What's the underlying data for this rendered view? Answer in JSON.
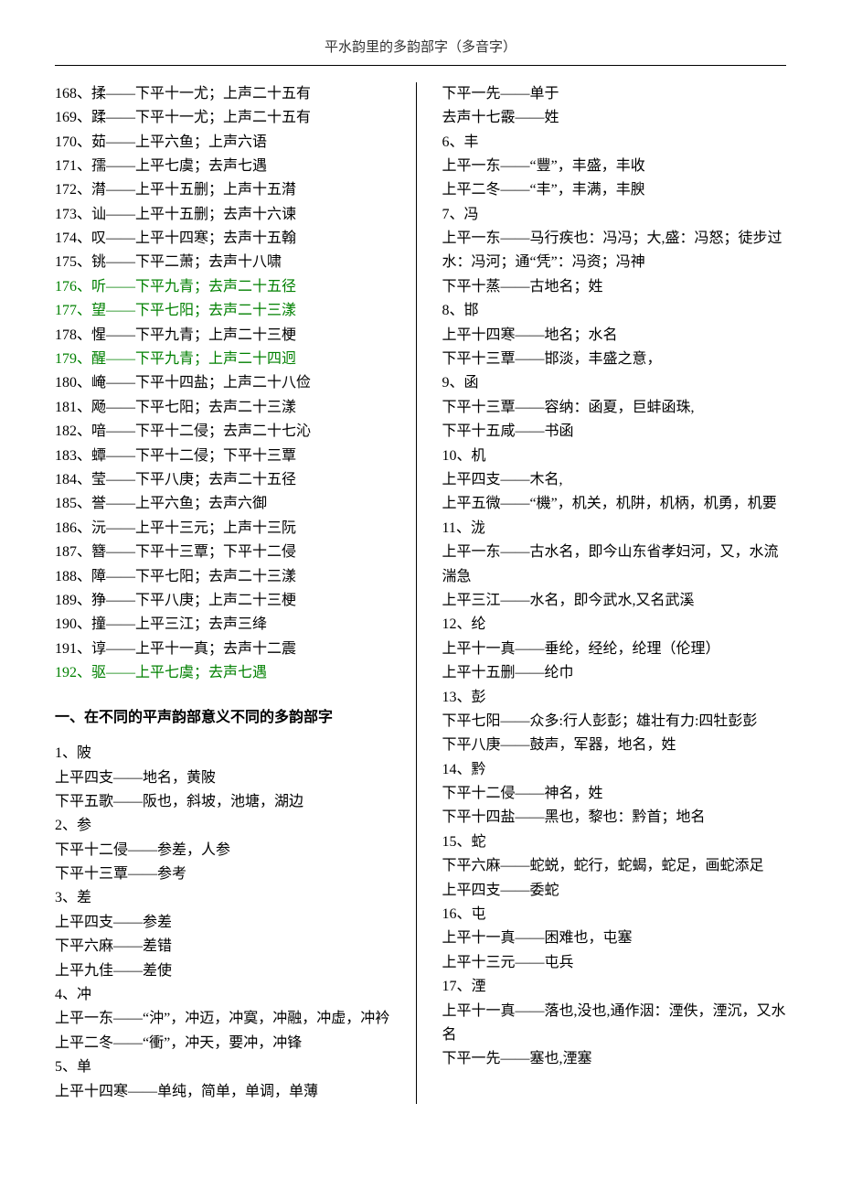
{
  "header": "平水韵里的多韵部字（多音字）",
  "left": {
    "items": [
      {
        "t": "168、揉——下平十一尤；上声二十五有"
      },
      {
        "t": "169、蹂——下平十一尤；上声二十五有"
      },
      {
        "t": "170、茹——上平六鱼；上声六语"
      },
      {
        "t": "171、孺——上平七虞；去声七遇"
      },
      {
        "t": "172、潸——上平十五删；上声十五潸"
      },
      {
        "t": "173、讪——上平十五删；去声十六谏"
      },
      {
        "t": "174、叹——上平十四寒；去声十五翰"
      },
      {
        "t": "175、铫——下平二萧；去声十八啸"
      },
      {
        "t": "176、听——下平九青；去声二十五径",
        "c": "green"
      },
      {
        "t": "177、望——下平七阳；去声二十三漾",
        "c": "green"
      },
      {
        "t": "178、惺——下平九青；上声二十三梗"
      },
      {
        "t": "179、醒——下平九青；上声二十四迥",
        "c": "green"
      },
      {
        "t": "180、崦——下平十四盐；上声二十八俭"
      },
      {
        "t": "181、飏——下平七阳；去声二十三漾"
      },
      {
        "t": "182、喑——下平十二侵；去声二十七沁"
      },
      {
        "t": "183、蟫——下平十二侵；下平十三覃"
      },
      {
        "t": "184、莹——下平八庚；去声二十五径"
      },
      {
        "t": "185、誉——上平六鱼；去声六御"
      },
      {
        "t": "186、沅——上平十三元；上声十三阮"
      },
      {
        "t": "187、簪——下平十三覃；下平十二侵"
      },
      {
        "t": "188、障——下平七阳；去声二十三漾"
      },
      {
        "t": "189、狰——下平八庚；上声二十三梗"
      },
      {
        "t": "190、撞——上平三江；去声三绛"
      },
      {
        "t": "191、谆——上平十一真；去声十二震"
      },
      {
        "t": "192、驱——上平七虞；去声七遇",
        "c": "green"
      }
    ],
    "section_title": "一、在不同的平声韵部意义不同的多韵部字",
    "section": [
      "1、陂",
      "上平四支——地名，黄陂",
      "下平五歌——阪也，斜坡，池塘，湖边",
      "2、参",
      "下平十二侵——参差，人参",
      "下平十三覃——参考",
      "3、差",
      "上平四支——参差",
      "下平六麻——差错",
      "上平九佳——差使",
      "4、冲",
      "上平一东——“沖”，冲迈，冲寞，冲融，冲虚，冲衿",
      "上平二冬——“衝”，冲天，要冲，冲锋",
      "5、单",
      "上平十四寒——单纯，简单，单调，单薄"
    ]
  },
  "right": [
    "下平一先——单于",
    "去声十七霰——姓",
    "6、丰",
    "上平一东——“豐”，丰盛，丰收",
    "上平二冬——“丰”，丰满，丰腴",
    "7、冯",
    "上平一东——马行疾也：冯冯；大,盛：冯怒；徒步过水：冯河；通“凭”：冯资；冯神",
    "下平十蒸——古地名；姓",
    "8、邯",
    "上平十四寒——地名；水名",
    "下平十三覃——邯淡，丰盛之意，",
    "9、函",
    "下平十三覃——容纳：函夏，巨蚌函珠,",
    "下平十五咸——书函",
    "10、机",
    "上平四支——木名,",
    "上平五微——“機”，机关，机阱，机柄，机勇，机要",
    "11、泷",
    "上平一东——古水名，即今山东省孝妇河，又，水流湍急",
    "上平三江——水名，即今武水,又名武溪",
    "12、纶",
    "上平十一真——垂纶，经纶，纶理（伦理）",
    "上平十五删——纶巾",
    "13、彭",
    "下平七阳——众多:行人彭彭；雄壮有力:四牡彭彭",
    "下平八庚——鼓声，军器，地名，姓",
    "14、黔",
    "下平十二侵——神名，姓",
    "下平十四盐——黑也，黎也：黔首；地名",
    "15、蛇",
    "下平六麻——蛇蜕，蛇行，蛇蝎，蛇足，画蛇添足",
    "上平四支——委蛇",
    "16、屯",
    "上平十一真——困难也，屯塞",
    "上平十三元——屯兵",
    "17、湮",
    "上平十一真——落也,没也,通作洇：湮佚，湮沉，又水名",
    "下平一先——塞也,湮塞"
  ]
}
